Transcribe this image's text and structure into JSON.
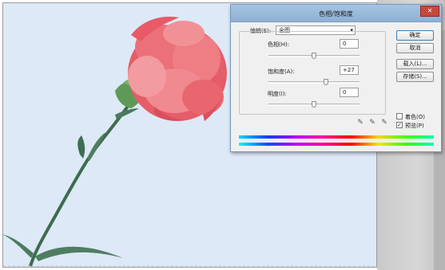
{
  "dialog": {
    "title": "色相/饱和度",
    "close_glyph": "✕",
    "edit": {
      "label": "编辑(E):",
      "value": "全图"
    },
    "hue": {
      "label": "色相(H):",
      "value": "0"
    },
    "saturation": {
      "label": "饱和度(A):",
      "value": "+27"
    },
    "lightness": {
      "label": "明度(I):",
      "value": "0"
    },
    "buttons": {
      "ok": "确定",
      "cancel": "取消",
      "load": "载入(L)...",
      "save": "存储(S)..."
    },
    "colorize": {
      "label": "着色(O)",
      "checked": false
    },
    "preview": {
      "label": "预览(P)",
      "checked": true,
      "check_glyph": "✓"
    },
    "eyedroppers": [
      "eyedropper-icon",
      "eyedropper-plus-icon",
      "eyedropper-minus-icon"
    ],
    "eyedropper_glyph": "✎"
  },
  "colors": {
    "photo_bg": "#dde9f6",
    "petal": "#e8616a",
    "stem": "#3d6b4f",
    "title_bar": "#9ab9db",
    "default_button_border": "#3c7fb1"
  }
}
